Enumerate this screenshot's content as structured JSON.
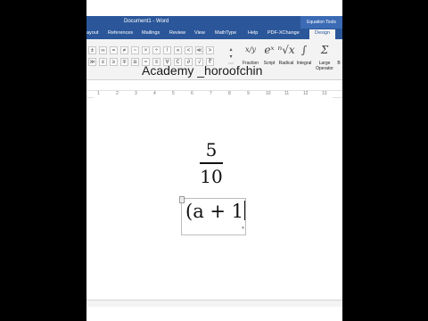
{
  "window": {
    "title": "Document1 - Word",
    "context_label": "Equation Tools"
  },
  "tabs": [
    {
      "label": "ayout"
    },
    {
      "label": "References"
    },
    {
      "label": "Mailings"
    },
    {
      "label": "Review"
    },
    {
      "label": "View"
    },
    {
      "label": "MathType"
    },
    {
      "label": "Help"
    },
    {
      "label": "PDF-XChange"
    },
    {
      "label": "Design"
    }
  ],
  "ribbon": {
    "symbols": [
      "±",
      "∞",
      "=",
      "≠",
      "~",
      "×",
      "÷",
      "!",
      "∝",
      "<",
      "≪",
      ">",
      "≫",
      "≤",
      "≥",
      "∓",
      "≅",
      "≈",
      "≡",
      "∀",
      "∁",
      "∂",
      "√",
      "∛"
    ],
    "structures": [
      {
        "label": "Fraction",
        "icon": "x/y"
      },
      {
        "label": "Script",
        "icon": "eˣ"
      },
      {
        "label": "Radical",
        "icon": "ⁿ√x"
      },
      {
        "label": "Integral",
        "icon": "∫"
      },
      {
        "label": "Large Operator",
        "icon": "Σ"
      },
      {
        "label": "B",
        "icon": ""
      }
    ]
  },
  "watermark": "Academy _horoofchin",
  "ruler": {
    "numbers": [
      "1",
      "2",
      "3",
      "4",
      "5",
      "6",
      "7",
      "8",
      "9",
      "10",
      "11",
      "12",
      "13"
    ]
  },
  "document": {
    "fraction": {
      "numerator": "5",
      "denominator": "10"
    },
    "equation": {
      "text": "(a + 1",
      "handle_icon": "⋮⋮",
      "dropdown_icon": "▾"
    }
  },
  "status": {
    "left": "",
    "zoom": ""
  }
}
